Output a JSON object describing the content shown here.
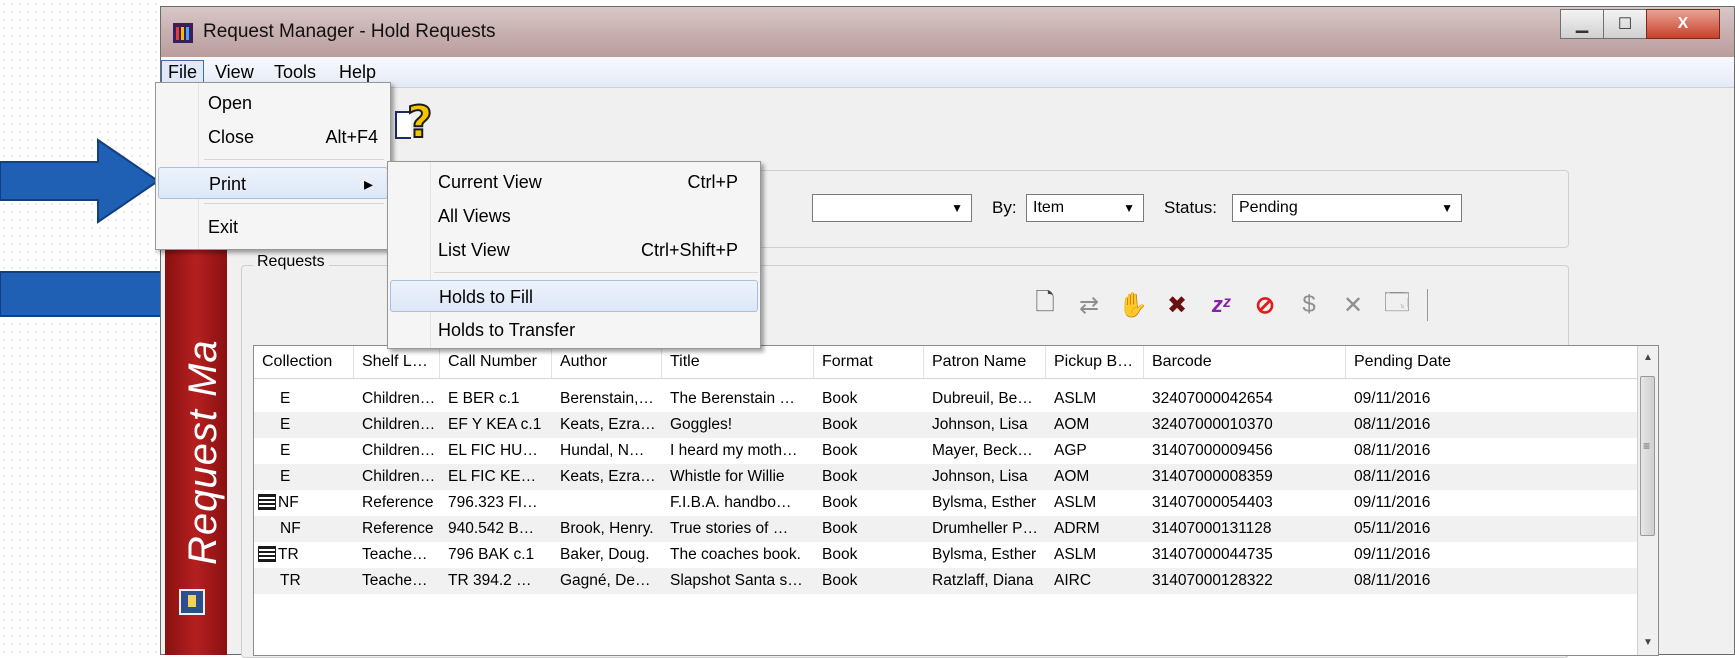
{
  "window": {
    "title": "Request Manager - Hold Requests",
    "sidebar_text": "Request Ma"
  },
  "menubar": {
    "file": "File",
    "view": "View",
    "tools": "Tools",
    "help": "Help"
  },
  "file_menu": {
    "open": "Open",
    "close": "Close",
    "close_shortcut": "Alt+F4",
    "print": "Print",
    "submenu_arrow": "▸",
    "exit": "Exit"
  },
  "print_menu": {
    "current_view": "Current View",
    "current_view_shortcut": "Ctrl+P",
    "all_views": "All Views",
    "list_view": "List View",
    "list_view_shortcut": "Ctrl+Shift+P",
    "holds_to_fill": "Holds to Fill",
    "holds_to_transfer": "Holds to Transfer"
  },
  "filters": {
    "by_label": "By:",
    "by_value": "Item",
    "status_label": "Status:",
    "status_value": "Pending"
  },
  "requests": {
    "label": "Requests",
    "columns": [
      "Collection",
      "Shelf L…",
      "Call Number",
      "Author",
      "Title",
      "Format",
      "Patron Name",
      "Pickup B…",
      "Barcode",
      "Pending Date"
    ],
    "rows": [
      {
        "collection": "E",
        "shelf": "Children…",
        "call": "E BER c.1",
        "author": "Berenstain,…",
        "title": "The Berenstain …",
        "format": "Book",
        "patron": "Dubreuil, Be…",
        "pickup": "ASLM",
        "barcode": "32407000042654",
        "date": "09/11/2016"
      },
      {
        "collection": "E",
        "shelf": "Children…",
        "call": "EF Y KEA c.1",
        "author": "Keats, Ezra…",
        "title": "Goggles!",
        "format": "Book",
        "patron": "Johnson, Lisa",
        "pickup": "AOM",
        "barcode": "32407000010370",
        "date": "08/11/2016"
      },
      {
        "collection": "E",
        "shelf": "Children…",
        "call": "EL FIC HU…",
        "author": "Hundal, N…",
        "title": "I heard my moth…",
        "format": "Book",
        "patron": "Mayer, Beck…",
        "pickup": "AGP",
        "barcode": "31407000009456",
        "date": "08/11/2016"
      },
      {
        "collection": "E",
        "shelf": "Children…",
        "call": "EL FIC KE…",
        "author": "Keats, Ezra…",
        "title": "Whistle for Willie",
        "format": "Book",
        "patron": "Johnson, Lisa",
        "pickup": "AOM",
        "barcode": "31407000008359",
        "date": "08/11/2016"
      },
      {
        "collection": "NF",
        "shelf": "Reference",
        "call": "796.323 FI…",
        "author": "",
        "title": "F.I.B.A. handbo…",
        "format": "Book",
        "patron": "Bylsma, Esther",
        "pickup": "ASLM",
        "barcode": "31407000054403",
        "date": "09/11/2016"
      },
      {
        "collection": "NF",
        "shelf": "Reference",
        "call": "940.542 B…",
        "author": "Brook, Henry.",
        "title": "True stories of …",
        "format": "Book",
        "patron": "Drumheller P…",
        "pickup": "ADRM",
        "barcode": "31407000131128",
        "date": "05/11/2016"
      },
      {
        "collection": "TR",
        "shelf": "Teache…",
        "call": "796 BAK c.1",
        "author": "Baker, Doug.",
        "title": "The coaches book.",
        "format": "Book",
        "patron": "Bylsma, Esther",
        "pickup": "ASLM",
        "barcode": "31407000044735",
        "date": "09/11/2016"
      },
      {
        "collection": "TR",
        "shelf": "Teache…",
        "call": "TR 394.2 …",
        "author": "Gagné, De…",
        "title": "Slapshot Santa s…",
        "format": "Book",
        "patron": "Ratzlaff, Diana",
        "pickup": "AIRC",
        "barcode": "31407000128322",
        "date": "08/11/2016"
      }
    ]
  },
  "window_buttons": {
    "minimize": "▁",
    "maximize": "☐",
    "close": "X"
  },
  "colors": {
    "arrow": "#1f5fb4",
    "sidebar": "#a51818",
    "highlight": "#dce7f7"
  }
}
